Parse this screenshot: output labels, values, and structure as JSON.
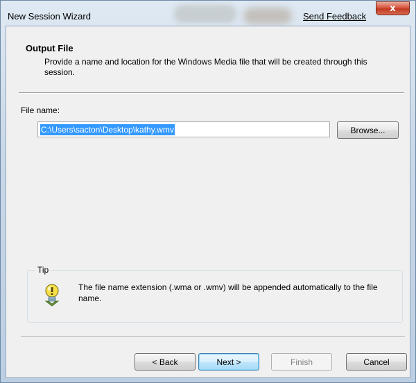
{
  "window": {
    "title": "New Session Wizard",
    "feedback_link": "Send Feedback",
    "close_glyph": "x"
  },
  "header": {
    "title": "Output File",
    "description": "Provide a name and location for the Windows Media file that will be created through this session."
  },
  "file_name": {
    "label": "File name:",
    "value": "C:\\Users\\sacton\\Desktop\\kathy.wmv",
    "browse_label": "Browse..."
  },
  "tip": {
    "label": "Tip",
    "icon": "lightbulb-icon",
    "text": "The file name extension (.wma or .wmv) will be appended automatically to the file name."
  },
  "buttons": {
    "back": "< Back",
    "next": "Next >",
    "finish": "Finish",
    "cancel": "Cancel"
  },
  "colors": {
    "selection": "#3399ff",
    "close_button": "#c13a22",
    "default_button_border": "#3c7fb1"
  }
}
